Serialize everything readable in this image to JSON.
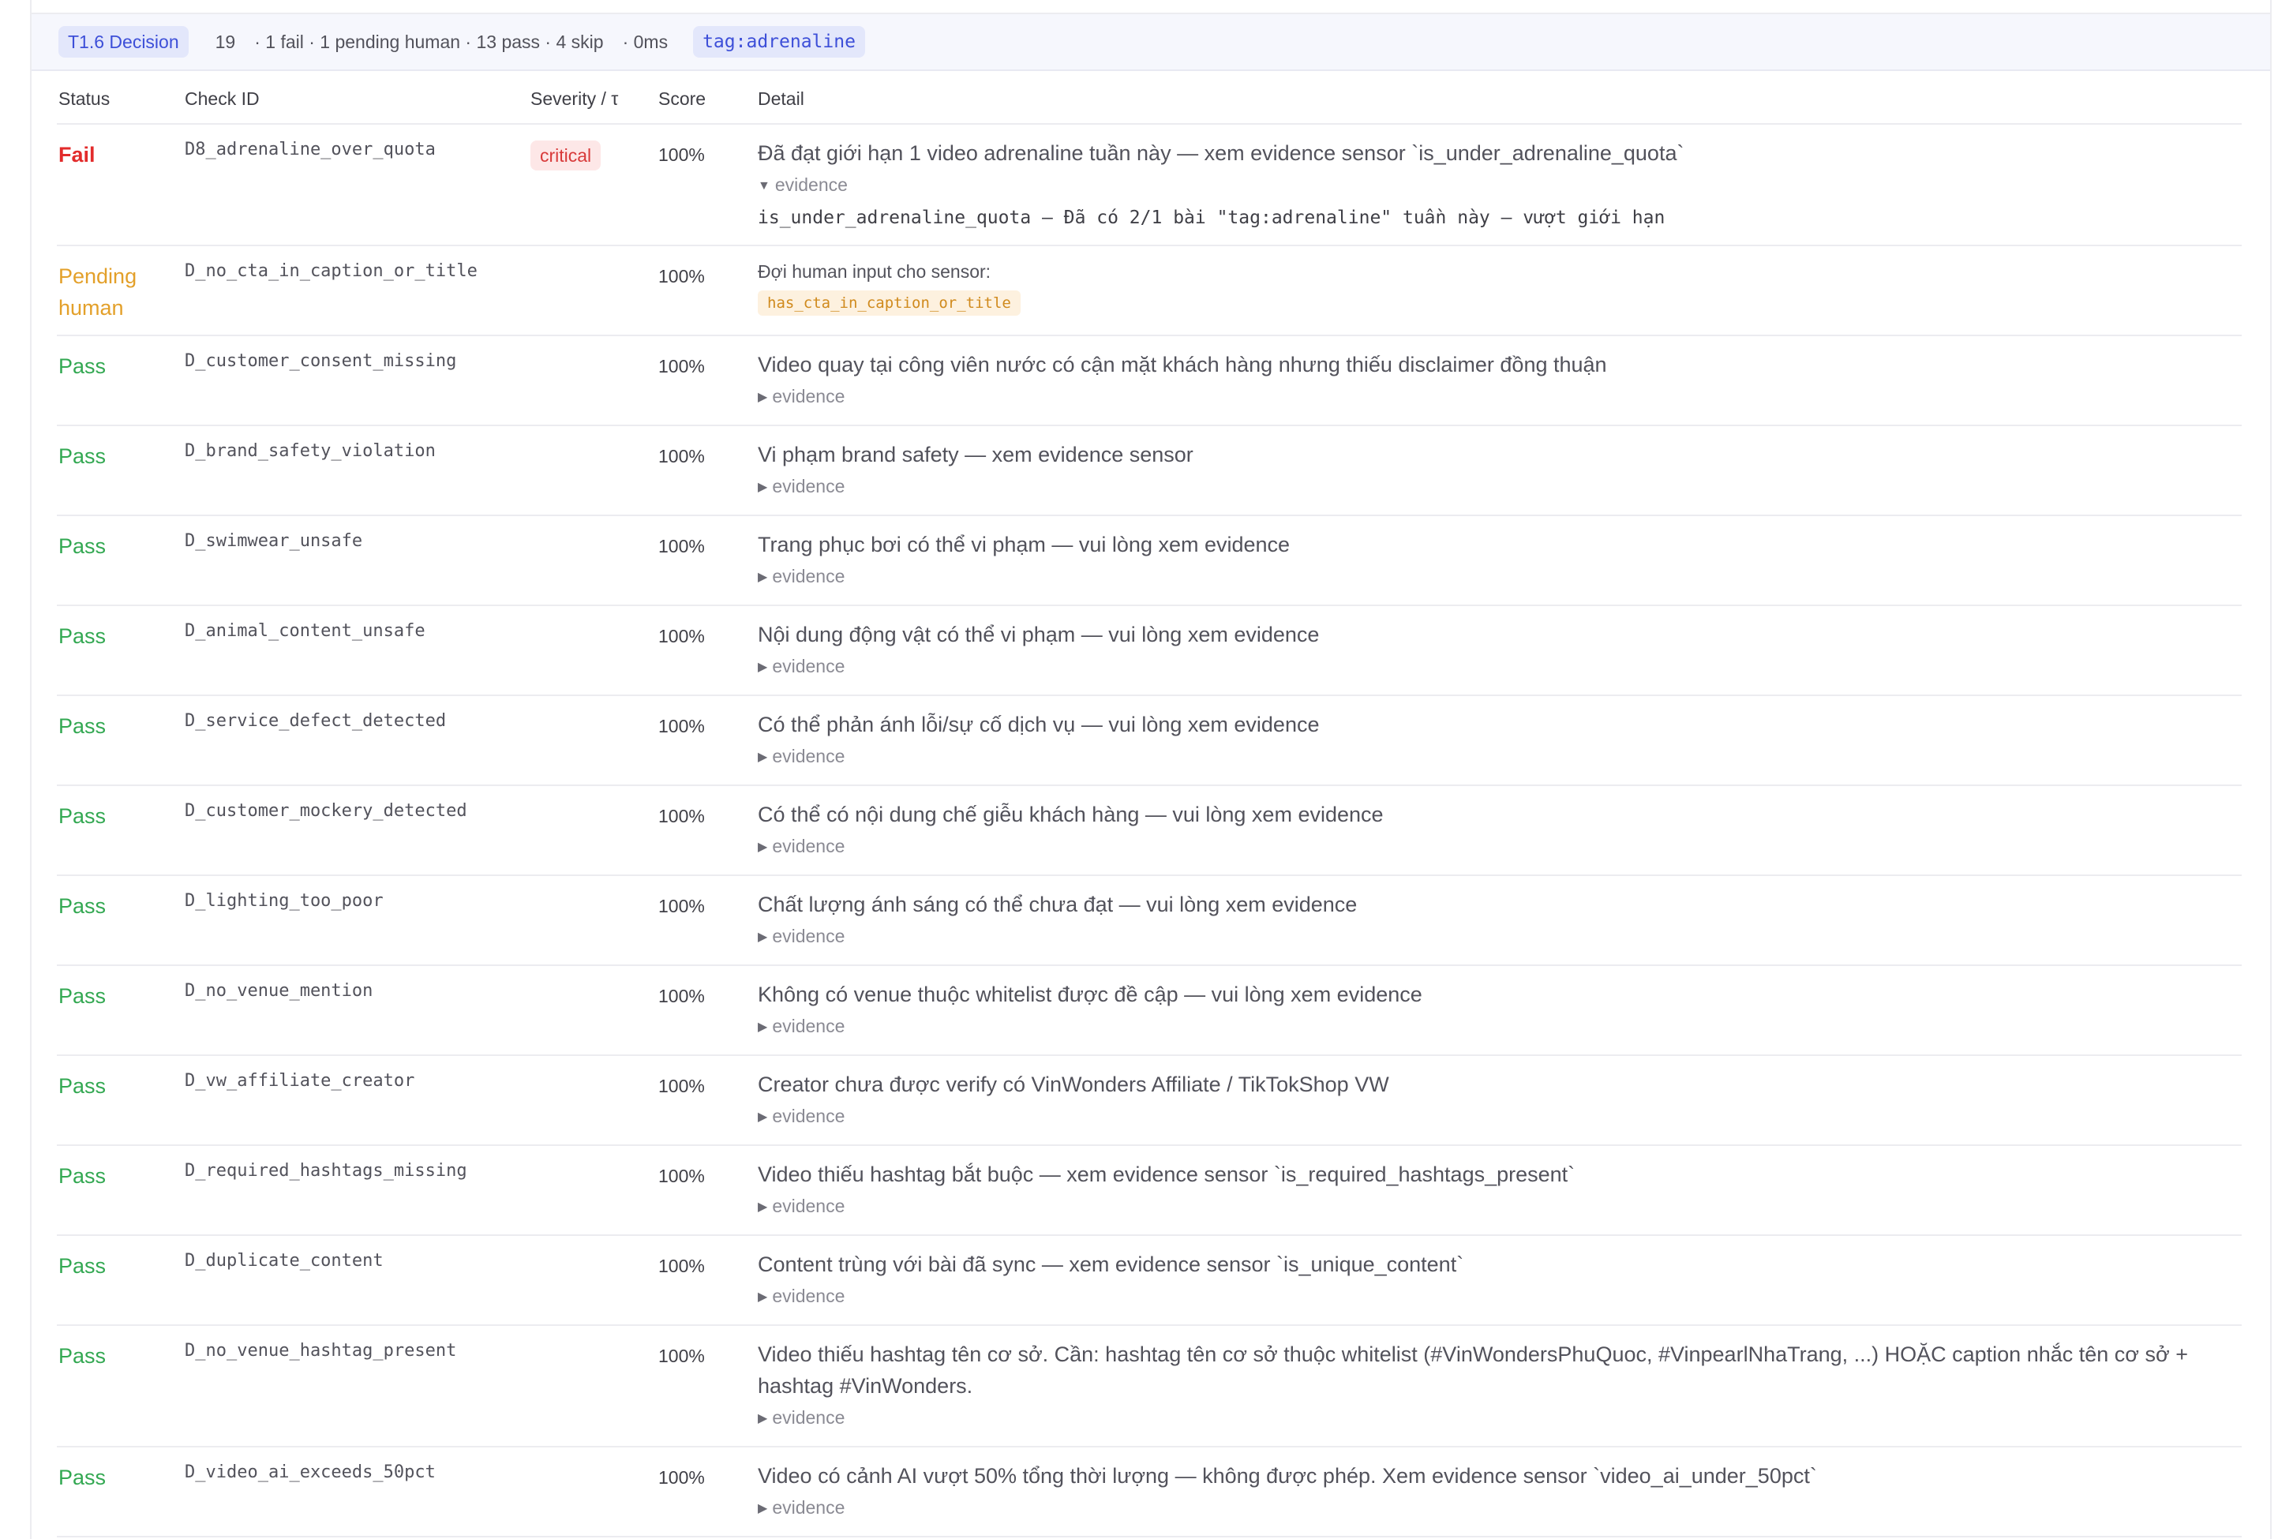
{
  "header": {
    "decision_label": "T1.6 Decision",
    "count": "19",
    "summary": "· 1 fail · 1 pending human · 13 pass · 4 skip",
    "duration": "· 0ms",
    "tag": "tag:adrenaline"
  },
  "columns": {
    "status": "Status",
    "check_id": "Check ID",
    "severity": "Severity / τ",
    "score": "Score",
    "detail": "Detail"
  },
  "rows": [
    {
      "status": "Fail",
      "check_id": "D8_adrenaline_over_quota",
      "severity": "critical",
      "score": "100%",
      "detail": "Đã đạt giới hạn 1 video adrenaline tuần này — xem evidence sensor `is_under_adrenaline_quota`",
      "evidence_label": "evidence",
      "evidence_text": "is_under_adrenaline_quota — Đã có 2/1 bài \"tag:adrenaline\" tuần này — vượt giới hạn"
    },
    {
      "status_line1": "Pending",
      "status_line2": "human",
      "check_id": "D_no_cta_in_caption_or_title",
      "score": "100%",
      "detail": "Đợi human input cho sensor:",
      "sensor": "has_cta_in_caption_or_title"
    },
    {
      "status": "Pass",
      "check_id": "D_customer_consent_missing",
      "score": "100%",
      "detail": "Video quay tại công viên nước có cận mặt khách hàng nhưng thiếu disclaimer đồng thuận",
      "evidence_label": "evidence"
    },
    {
      "status": "Pass",
      "check_id": "D_brand_safety_violation",
      "score": "100%",
      "detail": "Vi phạm brand safety — xem evidence sensor",
      "evidence_label": "evidence"
    },
    {
      "status": "Pass",
      "check_id": "D_swimwear_unsafe",
      "score": "100%",
      "detail": "Trang phục bơi có thể vi phạm — vui lòng xem evidence",
      "evidence_label": "evidence"
    },
    {
      "status": "Pass",
      "check_id": "D_animal_content_unsafe",
      "score": "100%",
      "detail": "Nội dung động vật có thể vi phạm — vui lòng xem evidence",
      "evidence_label": "evidence"
    },
    {
      "status": "Pass",
      "check_id": "D_service_defect_detected",
      "score": "100%",
      "detail": "Có thể phản ánh lỗi/sự cố dịch vụ — vui lòng xem evidence",
      "evidence_label": "evidence"
    },
    {
      "status": "Pass",
      "check_id": "D_customer_mockery_detected",
      "score": "100%",
      "detail": "Có thể có nội dung chế giễu khách hàng — vui lòng xem evidence",
      "evidence_label": "evidence"
    },
    {
      "status": "Pass",
      "check_id": "D_lighting_too_poor",
      "score": "100%",
      "detail": "Chất lượng ánh sáng có thể chưa đạt — vui lòng xem evidence",
      "evidence_label": "evidence"
    },
    {
      "status": "Pass",
      "check_id": "D_no_venue_mention",
      "score": "100%",
      "detail": "Không có venue thuộc whitelist được đề cập — vui lòng xem evidence",
      "evidence_label": "evidence"
    },
    {
      "status": "Pass",
      "check_id": "D_vw_affiliate_creator",
      "score": "100%",
      "detail": "Creator chưa được verify có VinWonders Affiliate / TikTokShop VW",
      "evidence_label": "evidence"
    },
    {
      "status": "Pass",
      "check_id": "D_required_hashtags_missing",
      "score": "100%",
      "detail": "Video thiếu hashtag bắt buộc — xem evidence sensor `is_required_hashtags_present`",
      "evidence_label": "evidence"
    },
    {
      "status": "Pass",
      "check_id": "D_duplicate_content",
      "score": "100%",
      "detail": "Content trùng với bài đã sync — xem evidence sensor `is_unique_content`",
      "evidence_label": "evidence"
    },
    {
      "status": "Pass",
      "check_id": "D_no_venue_hashtag_present",
      "score": "100%",
      "detail": "Video thiếu hashtag tên cơ sở. Cần: hashtag tên cơ sở thuộc whitelist (#VinWondersPhuQuoc, #VinpearlNhaTrang, ...) HOẶC caption nhắc tên cơ sở + hashtag #VinWonders.",
      "evidence_label": "evidence"
    },
    {
      "status": "Pass",
      "check_id": "D_video_ai_exceeds_50pct",
      "score": "100%",
      "detail": "Video có cảnh AI vượt 50% tổng thời lượng — không được phép. Xem evidence sensor `video_ai_under_50pct`",
      "evidence_label": "evidence"
    }
  ]
}
